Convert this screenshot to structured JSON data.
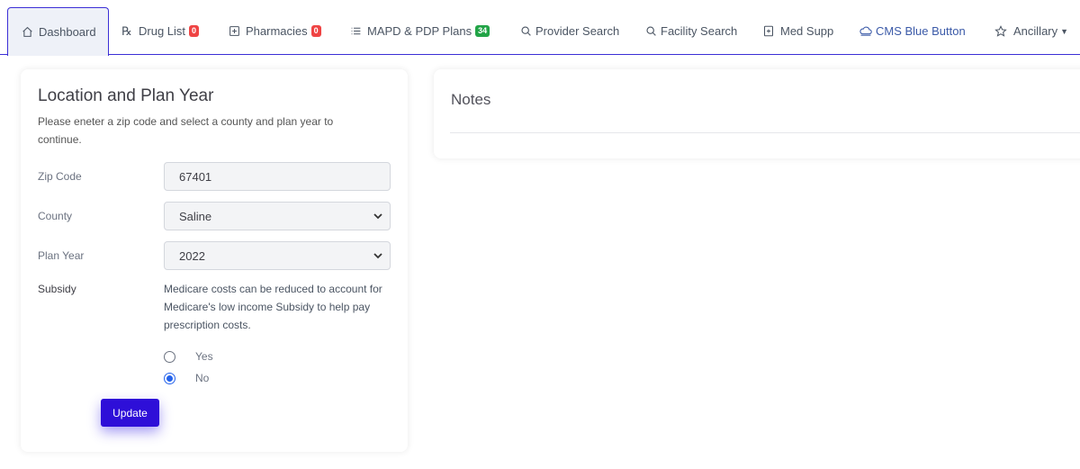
{
  "tabs": [
    {
      "label": "Dashboard",
      "icon": "home-icon"
    },
    {
      "label": "Drug List",
      "icon": "rx-icon",
      "badge": "0",
      "badge_color": "#ef4444"
    },
    {
      "label": "Pharmacies",
      "icon": "pharmacy-icon",
      "badge": "0",
      "badge_color": "#ef4444"
    },
    {
      "label": "MAPD & PDP Plans",
      "icon": "list-icon",
      "badge": "34",
      "badge_color": "#22a447"
    },
    {
      "label": "Provider Search",
      "icon": "search-icon"
    },
    {
      "label": "Facility Search",
      "icon": "search-icon"
    },
    {
      "label": "Med Supp",
      "icon": "medical-icon"
    },
    {
      "label": "CMS Blue Button",
      "icon": "cloud-icon"
    },
    {
      "label": "Ancillary",
      "icon": "star-icon"
    }
  ],
  "location": {
    "title": "Location and Plan Year",
    "description": "Please eneter a zip code and select a county and plan year to continue.",
    "zip_label": "Zip Code",
    "zip_value": "67401",
    "county_label": "County",
    "county_value": "Saline",
    "plan_year_label": "Plan Year",
    "plan_year_value": "2022",
    "subsidy_label": "Subsidy",
    "subsidy_text": "Medicare costs can be reduced to account for Medicare's low income Subsidy to help pay prescription costs.",
    "option_yes": "Yes",
    "option_no": "No",
    "selected_option": "No",
    "update_label": "Update"
  },
  "notes": {
    "title": "Notes"
  },
  "colors": {
    "accent": "#2e0fd8",
    "tab_border": "#3b2fd6",
    "cms_link": "#3b5aa8"
  }
}
